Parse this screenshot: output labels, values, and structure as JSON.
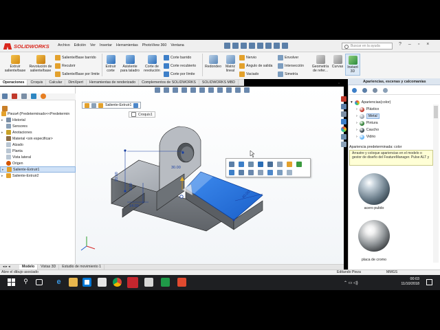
{
  "app": {
    "logo": "SOLIDWORKS"
  },
  "menu": [
    "Archivo",
    "Edición",
    "Ver",
    "Insertar",
    "Herramientas",
    "PhotoView 360",
    "Ventana"
  ],
  "search": {
    "placeholder": "Buscar en la ayuda"
  },
  "ribbon": {
    "extrude": "Extruir saliente/base",
    "revolve": "Revolución de saliente/base",
    "sweep": "Saliente/Base barrido",
    "loft": "Recubrir",
    "boundary": "Saliente/Base por límite",
    "cut_extrude": "Extruir corte",
    "hole_wizard": "Asistente para taladro",
    "cut_revolve": "Corte de revolución",
    "cut_sweep": "Corte barrido",
    "cut_loft": "Corte recubierto",
    "cut_boundary": "Corte por límite",
    "fillet": "Redondeo",
    "linear_pattern": "Matriz lineal",
    "rib": "Nervio",
    "draft": "Ángulo de salida",
    "shell": "Vaciado",
    "wrap": "Envolver",
    "intersect": "Intersección",
    "mirror": "Simetría",
    "ref_geometry": "Geometría de refer...",
    "curves": "Curvas",
    "instant3d": "Instant 3D"
  },
  "tabs": [
    "Operaciones",
    "Croquis",
    "Calcular",
    "DimXpert",
    "Herramientas de renderizado",
    "Complementos de SOLIDWORKS",
    "SOLIDWORKS MBD"
  ],
  "feature_tree": {
    "part": "Pieza4  (Predeterminado<<Predetermin",
    "items": [
      {
        "label": "Historial",
        "icon": "history-icon",
        "arrow": "▸"
      },
      {
        "label": "Sensores",
        "icon": "sensor-icon",
        "arrow": ""
      },
      {
        "label": "Anotaciones",
        "icon": "annotation-icon",
        "arrow": "▸"
      },
      {
        "label": "Material <sin especificar>",
        "icon": "material-icon",
        "arrow": ""
      },
      {
        "label": "Alzado",
        "icon": "plane-icon",
        "arrow": ""
      },
      {
        "label": "Planta",
        "icon": "plane-icon",
        "arrow": ""
      },
      {
        "label": "Vista lateral",
        "icon": "plane-icon",
        "arrow": ""
      },
      {
        "label": "Origen",
        "icon": "origin-icon",
        "arrow": ""
      },
      {
        "label": "Saliente-Extruir1",
        "icon": "extrude-icon",
        "arrow": "▸"
      },
      {
        "label": "Saliente-Extruir2",
        "icon": "extrude-icon",
        "arrow": "▸"
      }
    ]
  },
  "breadcrumb": {
    "feature": "Saliente-Extruir1",
    "sketch": "Croquis1"
  },
  "dimensions": {
    "d1": "20.00",
    "d2": "14.00",
    "d3": "6.00",
    "d4": "30.00",
    "d5": "40.00"
  },
  "bottom_tabs": [
    "Modelo",
    "Vistas 3D",
    "Estudio de movimiento 1"
  ],
  "status": {
    "left": "Abre el dibujo asociado",
    "mode": "Editando Pieza",
    "units": "MMGS"
  },
  "appearances": {
    "title": "Apariencias, escenas y calcomanías",
    "root": "Apariencias(color)",
    "items": [
      {
        "label": "Plástico",
        "color": "#c0392b"
      },
      {
        "label": "Metal",
        "color": "#9aa5ae"
      },
      {
        "label": "Pintura",
        "color": "#2e7d32"
      },
      {
        "label": "Caucho",
        "color": "#37474f"
      },
      {
        "label": "Vidrio",
        "color": "#64b5f6"
      }
    ],
    "predetermined": "Apariencia predeterminada: color",
    "tooltip": "Arrastre y coloque apariencias en el modelo o gestor de diseño del FeatureManager. Pulse ALT y",
    "materials": [
      "acero pulido",
      "placa de cromo"
    ]
  },
  "clock": {
    "time": "00:03",
    "date": "11/10/2018"
  },
  "colors": {
    "accent": "#1f6fd1",
    "face_highlight": "#2f7fe8",
    "logo": "#d9261c"
  }
}
